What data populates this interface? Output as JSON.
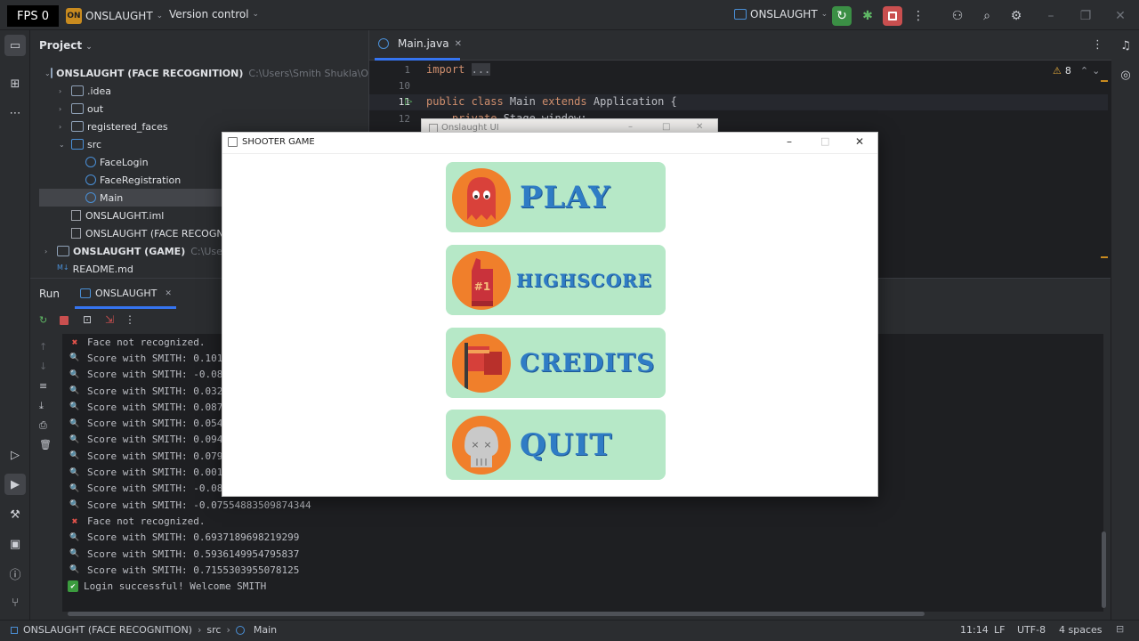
{
  "titlebar": {
    "fps": "FPS 0",
    "project_badge": "ON",
    "project_name": "ONSLAUGHT",
    "vcs": "Version control",
    "run_config": "ONSLAUGHT"
  },
  "project_panel": {
    "title": "Project",
    "tree": [
      {
        "label": "ONSLAUGHT (FACE RECOGNITION)",
        "hint": "C:\\Users\\Smith Shukla\\O",
        "kind": "module",
        "depth": 0,
        "expanded": true
      },
      {
        "label": ".idea",
        "kind": "folder",
        "depth": 1,
        "expanded": false
      },
      {
        "label": "out",
        "kind": "folder",
        "depth": 1,
        "expanded": false
      },
      {
        "label": "registered_faces",
        "kind": "folder",
        "depth": 1,
        "expanded": false
      },
      {
        "label": "src",
        "kind": "folder",
        "depth": 1,
        "expanded": true
      },
      {
        "label": "FaceLogin",
        "kind": "class",
        "depth": 2
      },
      {
        "label": "FaceRegistration",
        "kind": "class",
        "depth": 2
      },
      {
        "label": "Main",
        "kind": "class",
        "depth": 2,
        "selected": true
      },
      {
        "label": "ONSLAUGHT.iml",
        "kind": "file",
        "depth": 1
      },
      {
        "label": "ONSLAUGHT (FACE RECOGNI",
        "kind": "file",
        "depth": 1
      },
      {
        "label": "ONSLAUGHT (GAME)",
        "hint": "C:\\Users",
        "kind": "module",
        "depth": 0,
        "expanded": false
      },
      {
        "label": "README.md",
        "kind": "md",
        "depth": 0
      }
    ]
  },
  "editor": {
    "tab_label": "Main.java",
    "inspections": "8",
    "lines": [
      {
        "num": "1",
        "text": "import ..."
      },
      {
        "num": "10",
        "text": ""
      },
      {
        "num": "11",
        "text": "public class Main extends Application {"
      },
      {
        "num": "12",
        "text": "    private Stage window;  2 usages"
      }
    ]
  },
  "background_window": {
    "title": "Onslaught UI"
  },
  "game_window": {
    "title": "SHOOTER GAME",
    "buttons": [
      {
        "label": "PLAY",
        "icon": "ghost-icon"
      },
      {
        "label": "HIGHSCORE",
        "icon": "foam-finger-icon",
        "badge": "#1"
      },
      {
        "label": "CREDITS",
        "icon": "flag-icon"
      },
      {
        "label": "QUIT",
        "icon": "skull-icon"
      }
    ]
  },
  "run_panel": {
    "run_tab": "Run",
    "config_tab": "ONSLAUGHT",
    "console": [
      {
        "type": "error",
        "text": "Face not recognized."
      },
      {
        "type": "score",
        "text": "Score with SMITH: 0.101"
      },
      {
        "type": "score",
        "text": "Score with SMITH: -0.08"
      },
      {
        "type": "score",
        "text": "Score with SMITH: 0.032"
      },
      {
        "type": "score",
        "text": "Score with SMITH: 0.087"
      },
      {
        "type": "score",
        "text": "Score with SMITH: 0.054"
      },
      {
        "type": "score",
        "text": "Score with SMITH: 0.094"
      },
      {
        "type": "score",
        "text": "Score with SMITH: 0.079"
      },
      {
        "type": "score",
        "text": "Score with SMITH: 0.001"
      },
      {
        "type": "score",
        "text": "Score with SMITH: -0.08"
      },
      {
        "type": "score",
        "text": "Score with SMITH: -0.07554883509874344"
      },
      {
        "type": "error",
        "text": "Face not recognized."
      },
      {
        "type": "score",
        "text": "Score with SMITH: 0.6937189698219299"
      },
      {
        "type": "score",
        "text": "Score with SMITH: 0.5936149954795837"
      },
      {
        "type": "score",
        "text": "Score with SMITH: 0.7155303955078125"
      },
      {
        "type": "success",
        "text": "Login successful! Welcome SMITH"
      }
    ]
  },
  "statusbar": {
    "breadcrumb": [
      "ONSLAUGHT (FACE RECOGNITION)",
      "src",
      "Main"
    ],
    "position": "11:14",
    "line_sep": "LF",
    "encoding": "UTF-8",
    "indent": "4 spaces"
  },
  "colors": {
    "accent": "#3574f0",
    "button_bg": "#b6e8c7",
    "icon_circle": "#f07f2b",
    "label_blue": "#2f7cc5"
  }
}
